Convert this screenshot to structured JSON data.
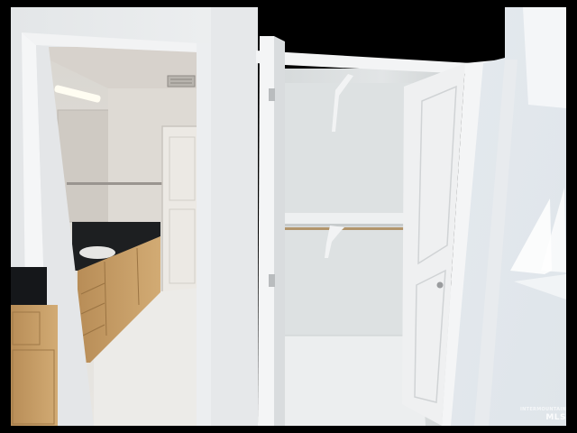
{
  "photo": {
    "watermark_small": "INTERMOUNTAIN",
    "watermark_mls": "MLS"
  },
  "colors": {
    "wall": "#e8eaec",
    "closet_interior": "#dfe3e4",
    "door_white": "#f3f4f5",
    "cabinet_wood": "#c9a16a",
    "countertop": "#1a1c1e",
    "floor": "#eceeef"
  }
}
